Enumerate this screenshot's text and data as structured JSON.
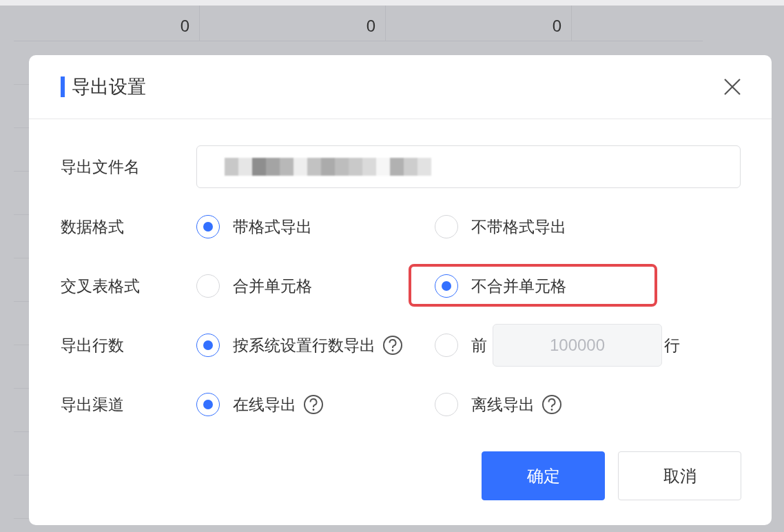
{
  "background_table": {
    "rows": [
      [
        "0",
        "0",
        "0"
      ]
    ]
  },
  "dialog": {
    "title": "导出设置",
    "file_name": {
      "label": "导出文件名",
      "value_redacted": true
    },
    "rows": [
      {
        "label": "数据格式",
        "options": [
          {
            "label": "带格式导出",
            "selected": true
          },
          {
            "label": "不带格式导出",
            "selected": false
          }
        ]
      },
      {
        "label": "交叉表格式",
        "options": [
          {
            "label": "合并单元格",
            "selected": false
          },
          {
            "label": "不合并单元格",
            "selected": true,
            "highlighted": true
          }
        ]
      },
      {
        "label": "导出行数",
        "options": [
          {
            "label": "按系统设置行数导出",
            "selected": true,
            "help": true
          },
          {
            "label": "前",
            "selected": false,
            "count": {
              "value": "100000",
              "disabled": true
            },
            "suffix": "行"
          }
        ]
      },
      {
        "label": "导出渠道",
        "options": [
          {
            "label": "在线导出",
            "selected": true,
            "help": true
          },
          {
            "label": "离线导出",
            "selected": false,
            "help": true
          }
        ]
      }
    ],
    "buttons": [
      {
        "label": "确定",
        "kind": "primary"
      },
      {
        "label": "取消",
        "kind": "default"
      }
    ]
  }
}
